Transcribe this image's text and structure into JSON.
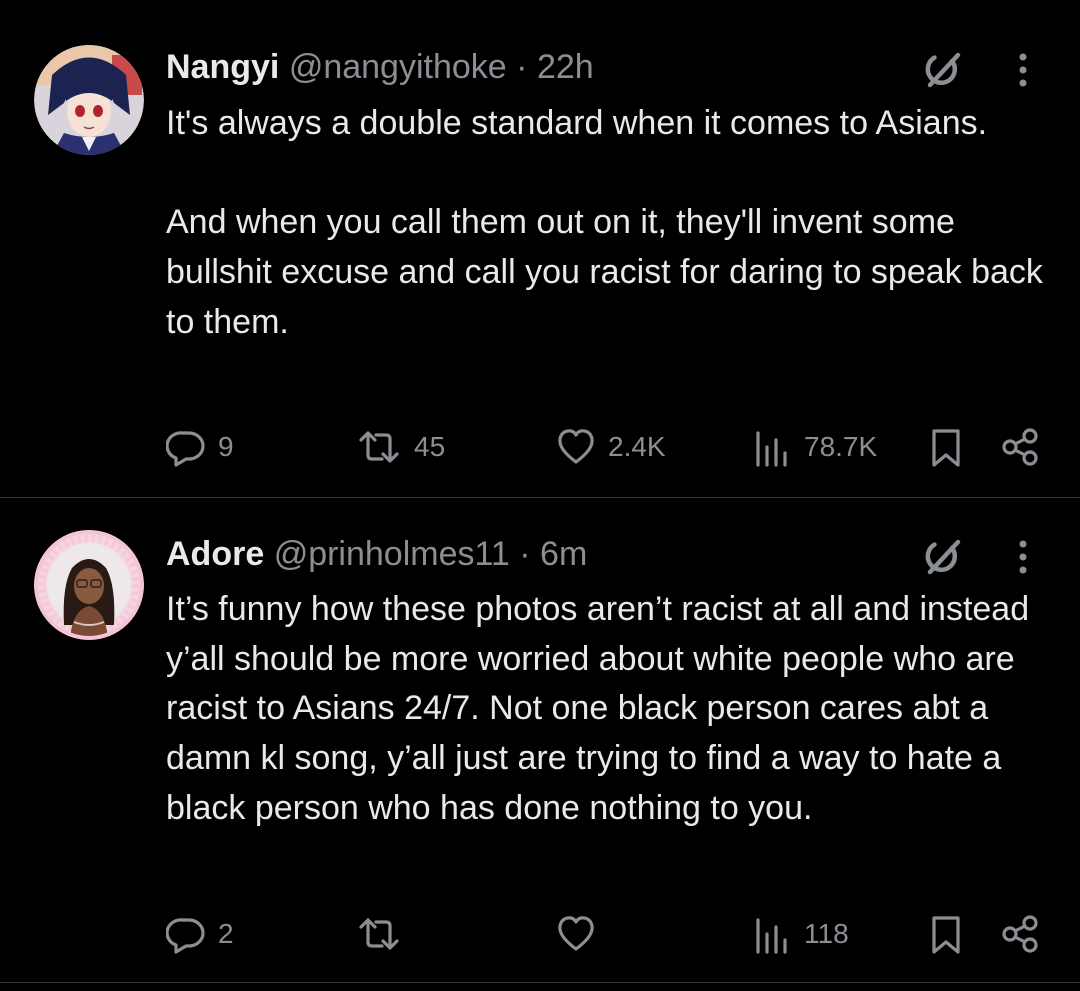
{
  "tweets": [
    {
      "display_name": "Nangyi",
      "handle": "@nangyithoke",
      "separator": "·",
      "time": "22h",
      "paragraphs": [
        "It's always a double standard when it comes to Asians.",
        "And when you call them out on it, they'll invent some bullshit excuse and call you racist for daring to speak back to them."
      ],
      "replies": "9",
      "reposts": "45",
      "likes": "2.4K",
      "views": "78.7K"
    },
    {
      "display_name": "Adore",
      "handle": "@prinholmes11",
      "separator": "·",
      "time": "6m",
      "paragraphs": [
        "It’s funny how these photos aren’t racist at all and instead y’all should be more worried about white people who are racist to Asians 24/7. Not one black person cares abt a damn kl song, y’all just are trying to find a way to hate a black person who has done nothing to you."
      ],
      "replies": "2",
      "reposts": "",
      "likes": "",
      "views": "118"
    }
  ],
  "icons": {
    "reply": "reply-icon",
    "repost": "repost-icon",
    "like": "heart-icon",
    "views": "views-icon",
    "bookmark": "bookmark-icon",
    "share": "share-icon",
    "grok": "grok-icon",
    "more": "more-icon"
  },
  "colors": {
    "background": "#000000",
    "text": "#e7e9ea",
    "secondary": "#8b8f94",
    "divider": "#2f3336"
  }
}
